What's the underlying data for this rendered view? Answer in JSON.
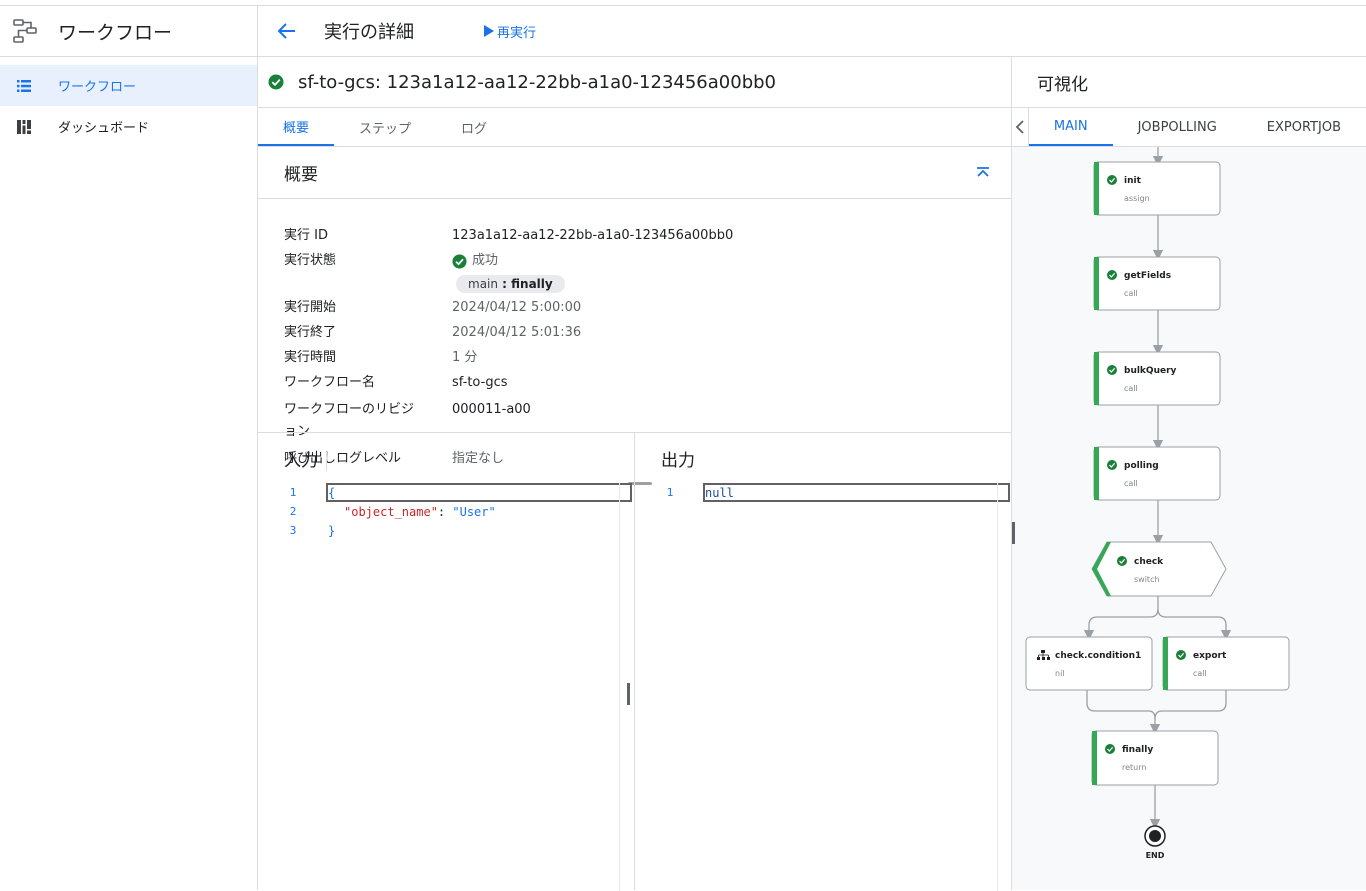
{
  "sidebar": {
    "title": "ワークフロー",
    "items": [
      {
        "label": "ワークフロー",
        "icon": "list-icon"
      },
      {
        "label": "ダッシュボード",
        "icon": "dashboard-icon"
      }
    ]
  },
  "header": {
    "title": "実行の詳細",
    "rerun_label": "再実行"
  },
  "execution": {
    "title": "sf-to-gcs: 123a1a12-aa12-22bb-a1a0-123456a00bb0",
    "tabs": [
      "概要",
      "ステップ",
      "ログ"
    ],
    "summary_title": "概要",
    "details": {
      "id_label": "実行 ID",
      "id_value": "123a1a12-aa12-22bb-a1a0-123456a00bb0",
      "status_label": "実行状態",
      "status_value": "成功",
      "chip_main": "main",
      "chip_step": " : finally",
      "start_label": "実行開始",
      "start_value": "2024/04/12 5:00:00",
      "end_label": "実行終了",
      "end_value": "2024/04/12 5:01:36",
      "duration_label": "実行時間",
      "duration_value": "1 分",
      "workflow_label": "ワークフロー名",
      "workflow_value": "sf-to-gcs",
      "revision_label_1": "ワークフローのリビジ",
      "revision_label_2": "ョン",
      "revision_value": "000011-a00",
      "loglevel_label": "呼び出しログレベル",
      "loglevel_value": "指定なし"
    }
  },
  "input": {
    "title": "入力",
    "lines": [
      {
        "num": "1",
        "text": "{"
      },
      {
        "num": "2",
        "key": "\"object_name\"",
        "sep": ": ",
        "value": "\"User\""
      },
      {
        "num": "3",
        "text": "}"
      }
    ]
  },
  "output": {
    "title": "出力",
    "lines": [
      {
        "num": "1",
        "text": "null"
      }
    ]
  },
  "visualization": {
    "title": "可視化",
    "tabs": [
      "MAIN",
      "JOBPOLLING",
      "EXPORTJOB"
    ],
    "nodes": [
      {
        "name": "init",
        "type": "assign"
      },
      {
        "name": "getFields",
        "type": "call"
      },
      {
        "name": "bulkQuery",
        "type": "call"
      },
      {
        "name": "polling",
        "type": "call"
      },
      {
        "name": "check",
        "type": "switch"
      },
      {
        "name": "check.condition1",
        "type": "nil"
      },
      {
        "name": "export",
        "type": "call"
      },
      {
        "name": "finally",
        "type": "return"
      }
    ],
    "end_label": "END"
  },
  "colors": {
    "accent": "#1a73e8",
    "success": "#188038",
    "node_bar": "#34a853"
  }
}
